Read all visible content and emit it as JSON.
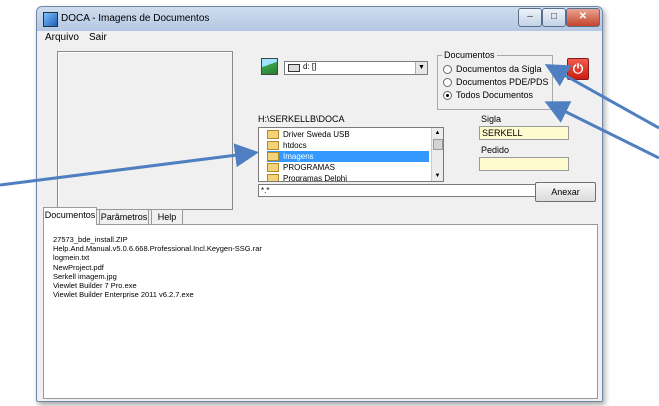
{
  "window": {
    "title": "DOCA - Imagens de Documentos",
    "minimize_glyph": "–",
    "restore_glyph": "□",
    "close_glyph": "✕"
  },
  "menu": [
    "Arquivo",
    "Sair"
  ],
  "drive": {
    "selected": "d: []",
    "arrow": "▼"
  },
  "path": "H:\\SERKELLB\\DOCA",
  "folders": [
    "Driver Sweda USB",
    "htdocs",
    "Imagens",
    "PROGRAMAS",
    "Programas Delphi"
  ],
  "selected_folder_index": 2,
  "filter": "*.*",
  "anexar_label": "Anexar",
  "documentos_group": {
    "title": "Documentos",
    "options": [
      "Documentos da Sigla",
      "Documentos PDE/PDS",
      "Todos Documentos"
    ],
    "selected_index": 2
  },
  "power_glyph": "⏻",
  "sigla": {
    "label": "Sigla",
    "value": "SERKELL"
  },
  "pedido": {
    "label": "Pedido",
    "value": ""
  },
  "tabs": [
    "Documentos",
    "Parâmetros",
    "Help"
  ],
  "active_tab_index": 0,
  "files": [
    "27573_bde_install.ZIP",
    "Help.And.Manual.v5.0.6.668.Professional.Incl.Keygen-SSG.rar",
    "logmein.txt",
    "NewProject.pdf",
    "Serkell imagem.jpg",
    "Viewlet Builder 7 Pro.exe",
    "Viewlet Builder Enterprise 2011 v6.2.7.exe"
  ],
  "colors": {
    "arrow": "#4f7fc0",
    "selection": "#3399ff",
    "field_bg": "#fffbd0"
  }
}
